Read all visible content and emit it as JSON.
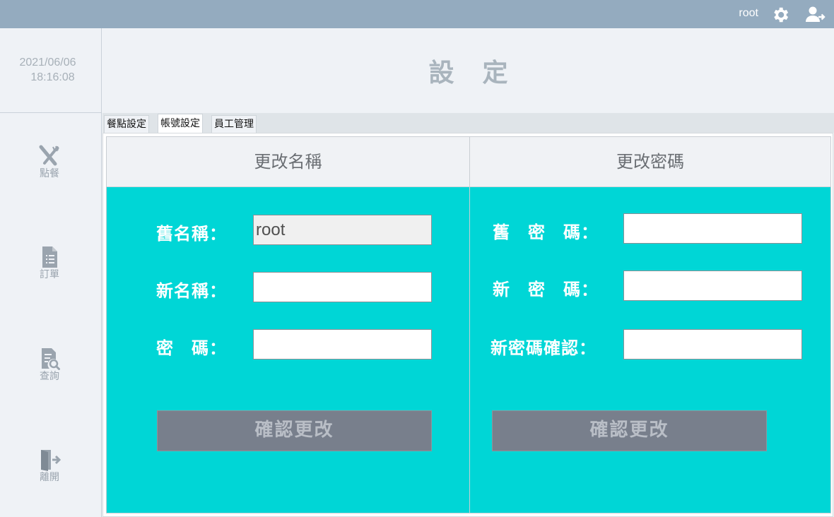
{
  "topbar": {
    "username": "root",
    "settings_icon": "gear-icon",
    "logout_icon": "user-logout-icon"
  },
  "clock": {
    "date": "2021/06/06",
    "time": "18:16:08"
  },
  "sidebar": {
    "items": [
      {
        "label": "點餐",
        "icon": "utensils-icon"
      },
      {
        "label": "訂單",
        "icon": "document-list-icon"
      },
      {
        "label": "查詢",
        "icon": "document-search-icon"
      },
      {
        "label": "離開",
        "icon": "exit-door-icon"
      }
    ]
  },
  "header": {
    "title": "設定"
  },
  "tabs": [
    {
      "label": "餐點設定",
      "active": false
    },
    {
      "label": "帳號設定",
      "active": true
    },
    {
      "label": "員工管理",
      "active": false
    }
  ],
  "rename": {
    "heading": "更改名稱",
    "old_name_label": "舊名稱：",
    "old_name_value": "root",
    "new_name_label": "新名稱：",
    "new_name_value": "",
    "password_label": "密　碼：",
    "password_value": "",
    "submit_label": "確認更改"
  },
  "change_password": {
    "heading": "更改密碼",
    "old_password_label": "舊　密　碼：",
    "old_password_value": "",
    "new_password_label": "新　密　碼：",
    "new_password_value": "",
    "confirm_password_label": "新密碼確認：",
    "confirm_password_value": "",
    "submit_label": "確認更改"
  },
  "colors": {
    "topbar": "#94abbf",
    "accent_panel": "#00d6d6",
    "button_bg": "#787f8c",
    "background": "#eff2f6"
  }
}
